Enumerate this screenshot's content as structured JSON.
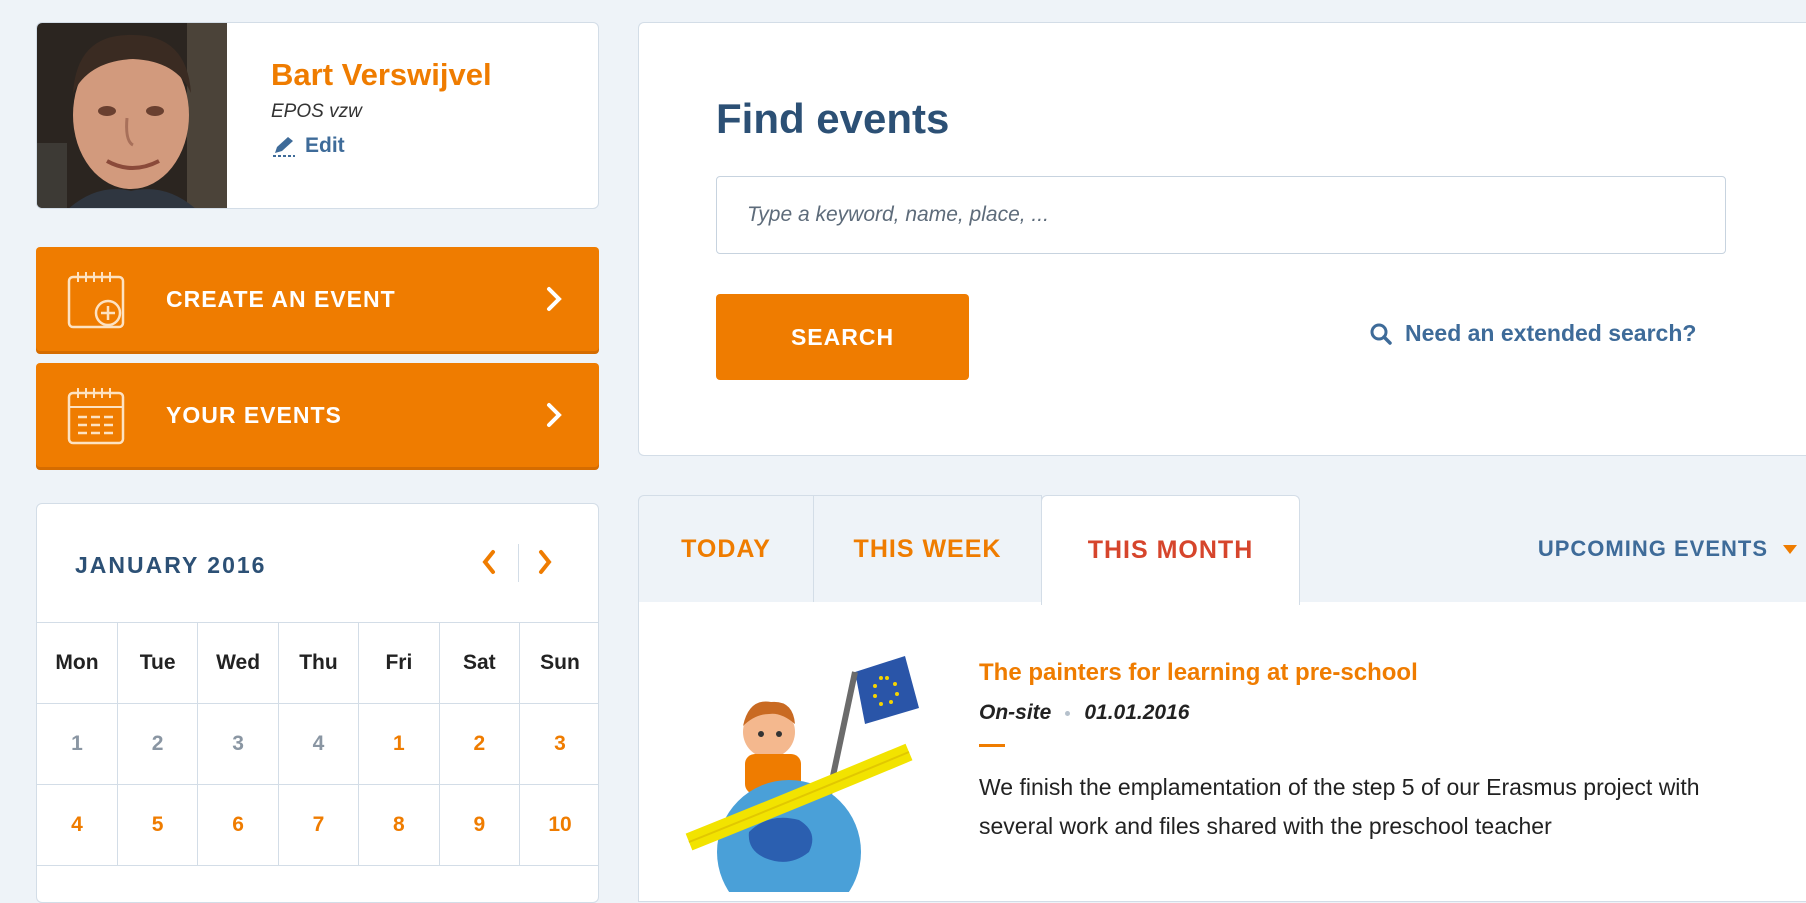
{
  "profile": {
    "name": "Bart Verswijvel",
    "organization": "EPOS vzw",
    "edit_label": "Edit",
    "avatar_icon": "user-photo"
  },
  "actions": {
    "create_event_label": "CREATE AN EVENT",
    "your_events_label": "YOUR EVENTS"
  },
  "calendar": {
    "month_label": "JANUARY 2016",
    "weekdays": [
      "Mon",
      "Tue",
      "Wed",
      "Thu",
      "Fri",
      "Sat",
      "Sun"
    ],
    "weeks": [
      [
        {
          "day": "1",
          "state": "prev"
        },
        {
          "day": "2",
          "state": "prev"
        },
        {
          "day": "3",
          "state": "prev"
        },
        {
          "day": "4",
          "state": "prev"
        },
        {
          "day": "1",
          "state": "cur"
        },
        {
          "day": "2",
          "state": "cur"
        },
        {
          "day": "3",
          "state": "cur"
        }
      ],
      [
        {
          "day": "4",
          "state": "cur"
        },
        {
          "day": "5",
          "state": "cur"
        },
        {
          "day": "6",
          "state": "cur"
        },
        {
          "day": "7",
          "state": "cur"
        },
        {
          "day": "8",
          "state": "cur"
        },
        {
          "day": "9",
          "state": "cur"
        },
        {
          "day": "10",
          "state": "cur"
        }
      ]
    ]
  },
  "search": {
    "title": "Find events",
    "placeholder": "Type a keyword, name, place, ...",
    "button_label": "SEARCH",
    "extended_label": "Need an extended search?"
  },
  "tabs": {
    "today": "TODAY",
    "week": "THIS WEEK",
    "month": "THIS MONTH",
    "upcoming": "UPCOMING EVENTS",
    "active": "month"
  },
  "events": [
    {
      "title": "The painters for learning at pre-school",
      "mode": "On-site",
      "date": "01.01.2016",
      "description": "We finish the emplamentation of the step 5 of our Erasmus project with several work and files shared with the preschool teacher"
    }
  ],
  "colors": {
    "accent": "#ef7c00",
    "heading": "#2c5075",
    "link": "#3e6b99",
    "active_tab": "#d6452c",
    "background": "#eef3f8"
  }
}
